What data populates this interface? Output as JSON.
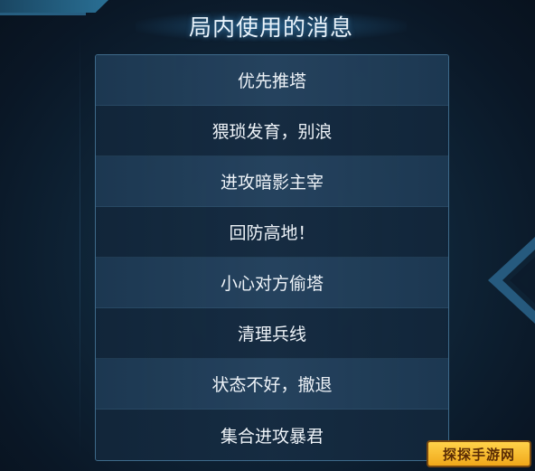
{
  "panel": {
    "title": "局内使用的消息",
    "messages": [
      "优先推塔",
      "猥琐发育，别浪",
      "进攻暗影主宰",
      "回防高地！",
      "小心对方偷塔",
      "清理兵线",
      "状态不好，撤退",
      "集合进攻暴君"
    ]
  },
  "branding": {
    "logo_text": "探探手游网"
  },
  "colors": {
    "background": "#0f2538",
    "row_light": "#26446a",
    "row_dark": "#162c42",
    "border": "#3e6a8a",
    "text": "#eef3f8"
  }
}
